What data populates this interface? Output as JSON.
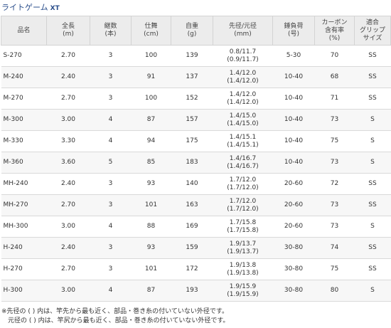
{
  "title": "ライトゲーム",
  "title_suffix": "XT",
  "table": {
    "headers": [
      "品名",
      "全長\n(m)",
      "継数\n(本)",
      "仕舞\n(cm)",
      "自重\n(g)",
      "先径/元径\n(mm)",
      "錘負荷\n(号)",
      "カーボン\n含有率\n(%)",
      "適合\nグリップ\nサイズ"
    ],
    "rows": [
      [
        "S-270",
        "2.70",
        "3",
        "100",
        "139",
        "0.8/11.7\n(0.9/11.7)",
        "5-30",
        "70",
        "SS"
      ],
      [
        "M-240",
        "2.40",
        "3",
        "91",
        "137",
        "1.4/12.0\n(1.4/12.0)",
        "10-40",
        "68",
        "SS"
      ],
      [
        "M-270",
        "2.70",
        "3",
        "100",
        "152",
        "1.4/12.0\n(1.4/12.0)",
        "10-40",
        "71",
        "SS"
      ],
      [
        "M-300",
        "3.00",
        "4",
        "87",
        "157",
        "1.4/15.0\n(1.4/15.0)",
        "10-40",
        "73",
        "S"
      ],
      [
        "M-330",
        "3.30",
        "4",
        "94",
        "175",
        "1.4/15.1\n(1.4/15.1)",
        "10-40",
        "75",
        "S"
      ],
      [
        "M-360",
        "3.60",
        "5",
        "85",
        "183",
        "1.4/16.7\n(1.4/16.7)",
        "10-40",
        "73",
        "S"
      ],
      [
        "MH-240",
        "2.40",
        "3",
        "93",
        "140",
        "1.7/12.0\n(1.7/12.0)",
        "20-60",
        "72",
        "SS"
      ],
      [
        "MH-270",
        "2.70",
        "3",
        "101",
        "163",
        "1.7/12.0\n(1.7/12.0)",
        "20-60",
        "73",
        "SS"
      ],
      [
        "MH-300",
        "3.00",
        "4",
        "88",
        "169",
        "1.7/15.8\n(1.7/15.8)",
        "20-60",
        "73",
        "S"
      ],
      [
        "H-240",
        "2.40",
        "3",
        "93",
        "159",
        "1.9/13.7\n(1.9/13.7)",
        "30-80",
        "74",
        "SS"
      ],
      [
        "H-270",
        "2.70",
        "3",
        "101",
        "172",
        "1.9/13.8\n(1.9/13.8)",
        "30-80",
        "75",
        "SS"
      ],
      [
        "H-300",
        "3.00",
        "4",
        "87",
        "193",
        "1.9/15.9\n(1.9/15.9)",
        "30-80",
        "80",
        "S"
      ]
    ]
  },
  "notes": [
    "※先径の ( ) 内は、竿先から最も近く、部品・巻き糸の付いていない外径です。",
    "　元径の ( ) 内は、竿尻から最も近く、部品・巻き糸の付いていない外径です。"
  ]
}
